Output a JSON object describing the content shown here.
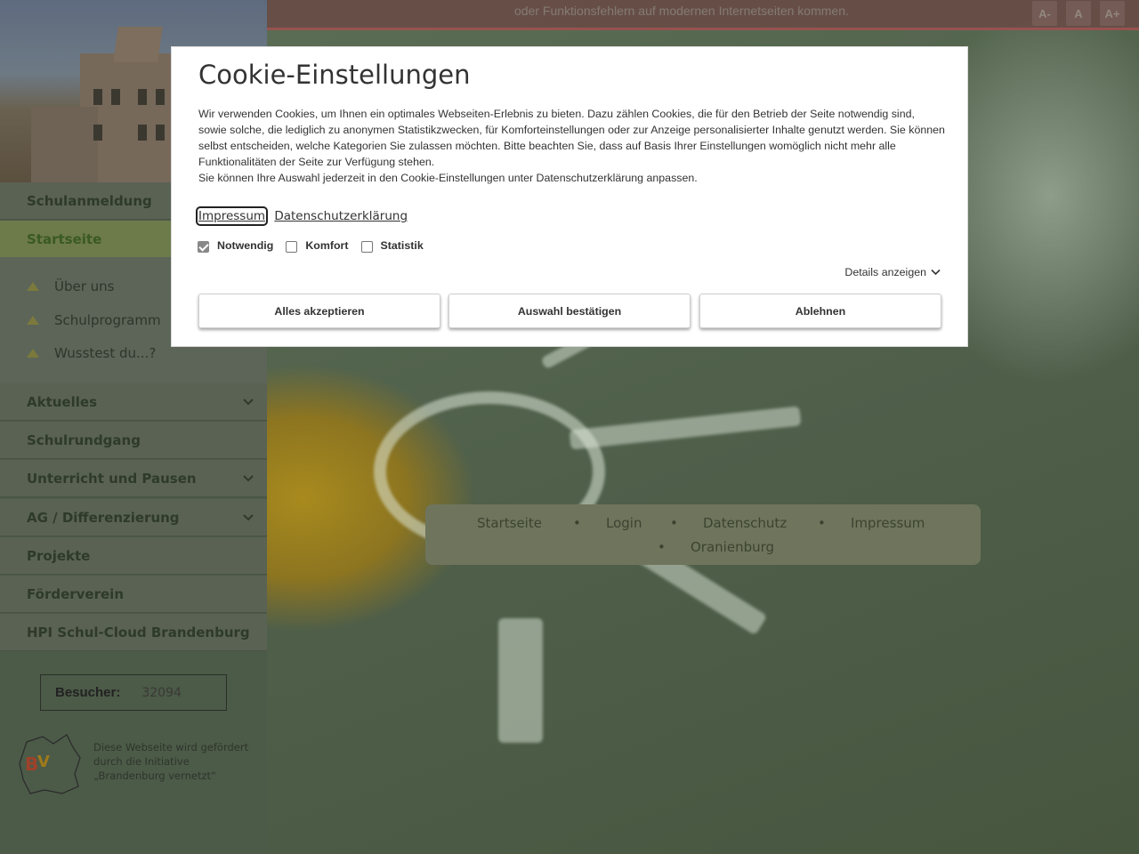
{
  "topbar": {
    "notice": "oder Funktionsfehlern auf modernen Internetseiten kommen.",
    "font_smaller": "A-",
    "font_normal": "A",
    "font_larger": "A+"
  },
  "sidebar": {
    "items": [
      {
        "label": "Schulanmeldung"
      },
      {
        "label": "Startseite"
      },
      {
        "label": "Aktuelles"
      },
      {
        "label": "Schulrundgang"
      },
      {
        "label": "Unterricht und Pausen"
      },
      {
        "label": "AG / Differenzierung"
      },
      {
        "label": "Projekte"
      },
      {
        "label": "Förderverein"
      },
      {
        "label": "HPI Schul-Cloud Brandenburg"
      }
    ],
    "subitems": [
      {
        "label": "Über uns"
      },
      {
        "label": "Schulprogramm"
      },
      {
        "label": "Wusstest du...?"
      }
    ],
    "visitor_label": "Besucher:",
    "visitor_count": "32094",
    "logo_text": "Diese Webseite wird gefördert durch die Initiative „Brandenburg vernetzt“"
  },
  "footer_nav": {
    "links": [
      "Startseite",
      "Login",
      "Datenschutz",
      "Impressum",
      "Oranienburg"
    ],
    "separator": "•"
  },
  "cookie_dialog": {
    "title": "Cookie-Einstellungen",
    "paragraph1": "Wir verwenden Cookies, um Ihnen ein optimales Webseiten-Erlebnis zu bieten. Dazu zählen Cookies, die für den Betrieb der Seite notwendig sind, sowie solche, die lediglich zu anonymen Statistikzwecken, für Komforteinstellungen oder zur Anzeige personalisierter Inhalte genutzt werden. Sie können selbst entscheiden, welche Kategorien Sie zulassen möchten. Bitte beachten Sie, dass auf Basis Ihrer Einstellungen womöglich nicht mehr alle Funktionalitäten der Seite zur Verfügung stehen.",
    "paragraph2": "Sie können Ihre Auswahl jederzeit in den Cookie-Einstellungen unter Datenschutzerklärung anpassen.",
    "link_impressum": "Impressum",
    "link_privacy": "Datenschutzerklärung",
    "checkboxes": [
      {
        "label": "Notwendig",
        "checked": true
      },
      {
        "label": "Komfort",
        "checked": false
      },
      {
        "label": "Statistik",
        "checked": false
      }
    ],
    "details_label": "Details anzeigen",
    "btn_accept_all": "Alles akzeptieren",
    "btn_confirm": "Auswahl bestätigen",
    "btn_decline": "Ablehnen"
  }
}
